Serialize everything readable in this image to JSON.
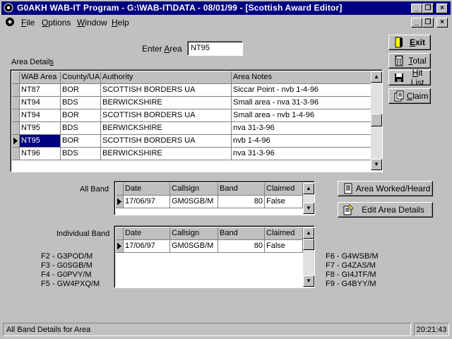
{
  "window": {
    "title": "G0AKH WAB-IT Program - G:\\WAB-IT\\DATA - 08/01/99 - [Scottish Award Editor]",
    "minimize": "_",
    "restore": "🗗",
    "close": "×"
  },
  "menu": {
    "items": [
      {
        "hotkey": "F",
        "rest": "ile"
      },
      {
        "hotkey": "O",
        "rest": "ptions"
      },
      {
        "hotkey": "W",
        "rest": "indow"
      },
      {
        "hotkey": "H",
        "rest": "elp"
      }
    ]
  },
  "enter_area": {
    "label_pre": "Enter ",
    "hotkey": "A",
    "label_post": "rea",
    "value": "NT95"
  },
  "area_details": {
    "label": "Area Detail",
    "hotkey": "s",
    "columns": [
      "WAB Area",
      "County/UA",
      "Authority",
      "Area Notes"
    ],
    "rows": [
      [
        "NT87",
        "BOR",
        "SCOTTISH BORDERS UA",
        "Siccar Point - nvb 1-4-96"
      ],
      [
        "NT94",
        "BDS",
        "BERWICKSHIRE",
        "Small area - nva 31-3-96"
      ],
      [
        "NT94",
        "BOR",
        "SCOTTISH BORDERS UA",
        "Small area - nvb 1-4-96"
      ],
      [
        "NT95",
        "BDS",
        "BERWICKSHIRE",
        "nva 31-3-96"
      ],
      [
        "NT95",
        "BOR",
        "SCOTTISH BORDERS UA",
        "nvb 1-4-96"
      ],
      [
        "NT96",
        "BDS",
        "BERWICKSHIRE",
        "nva 31-3-96"
      ]
    ],
    "current_row": 4
  },
  "buttons": {
    "exit": {
      "hotkey": "E",
      "rest": "xit"
    },
    "total": {
      "hotkey": "T",
      "rest": "otal"
    },
    "hitlist": {
      "hotkey": "H",
      "rest": "it List"
    },
    "claim": {
      "hotkey": "C",
      "rest": "laim"
    },
    "area_worked": "Area Worked/Heard",
    "edit_area": "Edit Area Details"
  },
  "all_band": {
    "label": "All Band",
    "columns": [
      "Date",
      "Callsign",
      "Band",
      "Claimed"
    ],
    "rows": [
      [
        "17/06/97",
        "GM0SGB/M",
        "80",
        "False"
      ]
    ]
  },
  "individual_band": {
    "label": "Individual Band",
    "columns": [
      "Date",
      "Callsign",
      "Band",
      "Claimed"
    ],
    "rows": [
      [
        "17/06/97",
        "GM0SGB/M",
        "80",
        "False"
      ]
    ]
  },
  "function_keys": {
    "left": [
      "F2 - G3POD/M",
      "F3 - G0SGB/M",
      "F4 - G0PVY/M",
      "F5 - GW4PXQ/M"
    ],
    "right": [
      "F6 - G4WSB/M",
      "F7 - G4ZAS/M",
      "F8 - GI4JTF/M",
      "F9 - G4BYY/M"
    ]
  },
  "status": {
    "message": "All Band Details for Area",
    "time": "20:21:43"
  }
}
